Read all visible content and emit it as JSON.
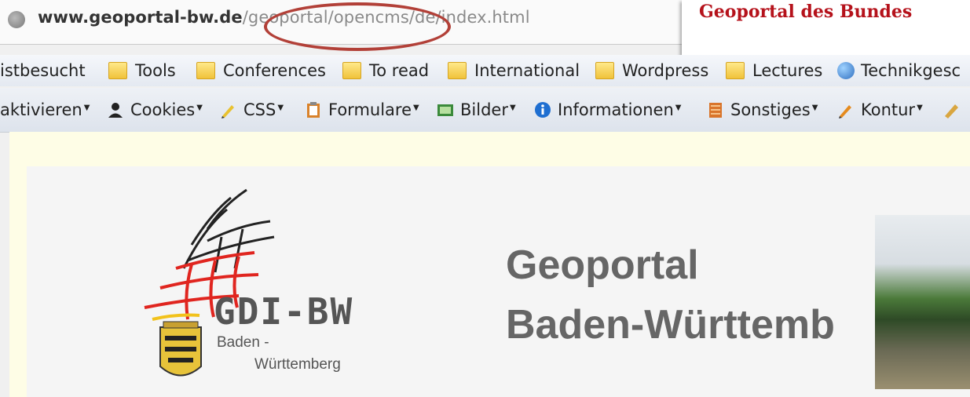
{
  "url": {
    "domain": "www.geoportal-bw.de",
    "path": "/geoportal/opencms/de/index.html"
  },
  "tab_tooltip": {
    "title": "Geoportal des Bundes"
  },
  "bookmarks": {
    "items": [
      {
        "label": "istbesucht",
        "icon": "none"
      },
      {
        "label": "Tools",
        "icon": "folder-icon"
      },
      {
        "label": "Conferences",
        "icon": "folder-icon"
      },
      {
        "label": "To read",
        "icon": "folder-icon"
      },
      {
        "label": "International",
        "icon": "folder-icon"
      },
      {
        "label": "Wordpress",
        "icon": "folder-icon"
      },
      {
        "label": "Lectures",
        "icon": "folder-icon"
      },
      {
        "label": "Technikgesc",
        "icon": "globe-icon"
      }
    ]
  },
  "devbar": {
    "items": [
      {
        "label": "aktivieren",
        "icon": "none"
      },
      {
        "label": "Cookies",
        "icon": "person-icon"
      },
      {
        "label": "CSS",
        "icon": "pencil-icon"
      },
      {
        "label": "Formulare",
        "icon": "clipboard-icon"
      },
      {
        "label": "Bilder",
        "icon": "image-icon"
      },
      {
        "label": "Informationen",
        "icon": "info-icon"
      },
      {
        "label": "Sonstiges",
        "icon": "book-icon"
      },
      {
        "label": "Kontur",
        "icon": "pencil-icon"
      }
    ]
  },
  "page": {
    "logo": {
      "main": "GDI-BW",
      "line1": "Baden -",
      "line2": "Württemberg"
    },
    "title_line1": "Geoportal",
    "title_line2": "Baden-Württemb"
  },
  "colors": {
    "annotation": "#b24038",
    "tab_title": "#b5121b",
    "page_text": "#666666"
  }
}
